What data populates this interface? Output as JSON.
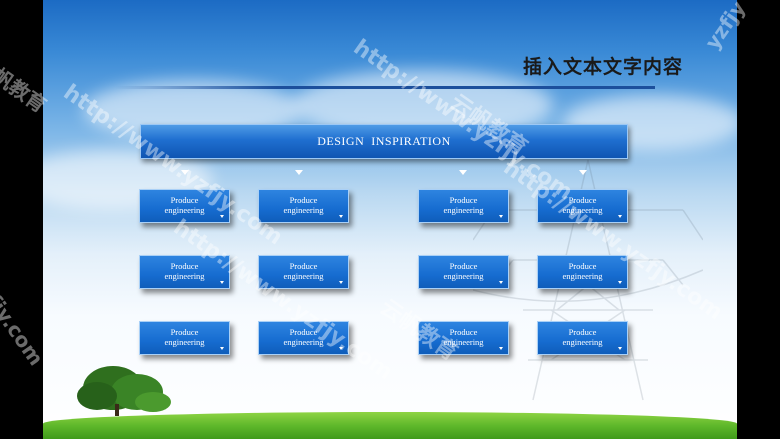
{
  "slide": {
    "title": "插入文本文字内容",
    "header": "DESIGN  INSPIRATION",
    "cards": [
      {
        "line1": "Produce",
        "line2": "engineering"
      },
      {
        "line1": "Produce",
        "line2": "engineering"
      },
      {
        "line1": "Produce",
        "line2": "engineering"
      },
      {
        "line1": "Produce",
        "line2": "engineering"
      },
      {
        "line1": "Produce",
        "line2": "engineering"
      },
      {
        "line1": "Produce",
        "line2": "engineering"
      },
      {
        "line1": "Produce",
        "line2": "engineering"
      },
      {
        "line1": "Produce",
        "line2": "engineering"
      },
      {
        "line1": "Produce",
        "line2": "engineering"
      },
      {
        "line1": "Produce",
        "line2": "engineering"
      },
      {
        "line1": "Produce",
        "line2": "engineering"
      },
      {
        "line1": "Produce",
        "line2": "engineering"
      }
    ]
  },
  "watermark": {
    "url": "http://www.yzfjy.com",
    "brand": "云帆教育",
    "fragment_top": "yzfjy",
    "fragment_left_url": "fjy.com",
    "fragment_left_brand": "帆教育"
  },
  "colors": {
    "accent": "#166cd0",
    "title_rule": "#1c4f9c",
    "title_text": "#1a1a1a"
  }
}
